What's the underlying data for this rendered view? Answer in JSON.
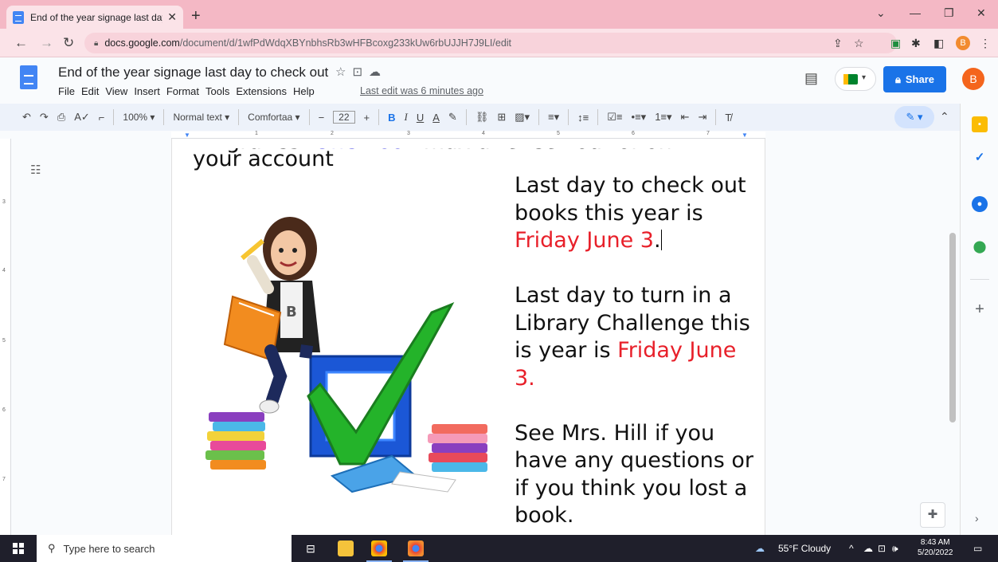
{
  "browser": {
    "tab_title": "End of the year signage last day",
    "tab_close": "✕",
    "new_tab": "+",
    "url_host": "docs.google.com",
    "url_path": "/document/d/1wfPdWdqXBYnbhsRb3wHFBcoxg233kUw6rbUJJH7J9LI/edit",
    "profile_initial": "B"
  },
  "doc": {
    "title": "End of the year signage last day to check out",
    "menu": [
      "File",
      "Edit",
      "View",
      "Insert",
      "Format",
      "Tools",
      "Extensions",
      "Help"
    ],
    "last_edit": "Last edit was 6 minutes ago",
    "share_label": "Share",
    "user_initial": "B"
  },
  "format_toolbar": {
    "zoom": "100%",
    "style": "Normal text",
    "font": "Comfortaa",
    "font_size": "22",
    "bold": "B",
    "italic": "I",
    "underline": "U",
    "text_color": "A"
  },
  "ruler": {
    "numbers": [
      "1",
      "2",
      "3",
      "4",
      "5",
      "6",
      "7"
    ],
    "vertical_numbers": [
      "3",
      "4",
      "5",
      "6",
      "7"
    ]
  },
  "content": {
    "top_partial_black": "All grades. ",
    "top_partial_blue": "One book",
    "top_partial_tail": " max at check out of on",
    "account_line": "your account",
    "para1_prefix": " Last day to check out books this year is ",
    "para1_red": "Friday June 3",
    "para1_suffix": ".",
    "para2_text": "Last day to turn in a Library Challenge this is year is ",
    "para2_red": "Friday June 3.",
    "para3_text": "See Mrs. Hill if you have any questions or if you think you lost a book."
  },
  "taskbar": {
    "search_placeholder": "Type here to search",
    "weather": "55°F  Cloudy",
    "time": "8:43 AM",
    "date": "5/20/2022"
  },
  "colors": {
    "red_text": "#e8202a",
    "blue_text": "#2a2ae0",
    "share_bg": "#1a73e8",
    "tab_strip": "#f4b8c5"
  },
  "icons": {
    "star": "star-icon",
    "move": "move-to-folder-icon",
    "cloud": "cloud-status-icon",
    "comments": "comment-history-icon",
    "meet": "meet-icon",
    "explore": "explore-icon"
  }
}
